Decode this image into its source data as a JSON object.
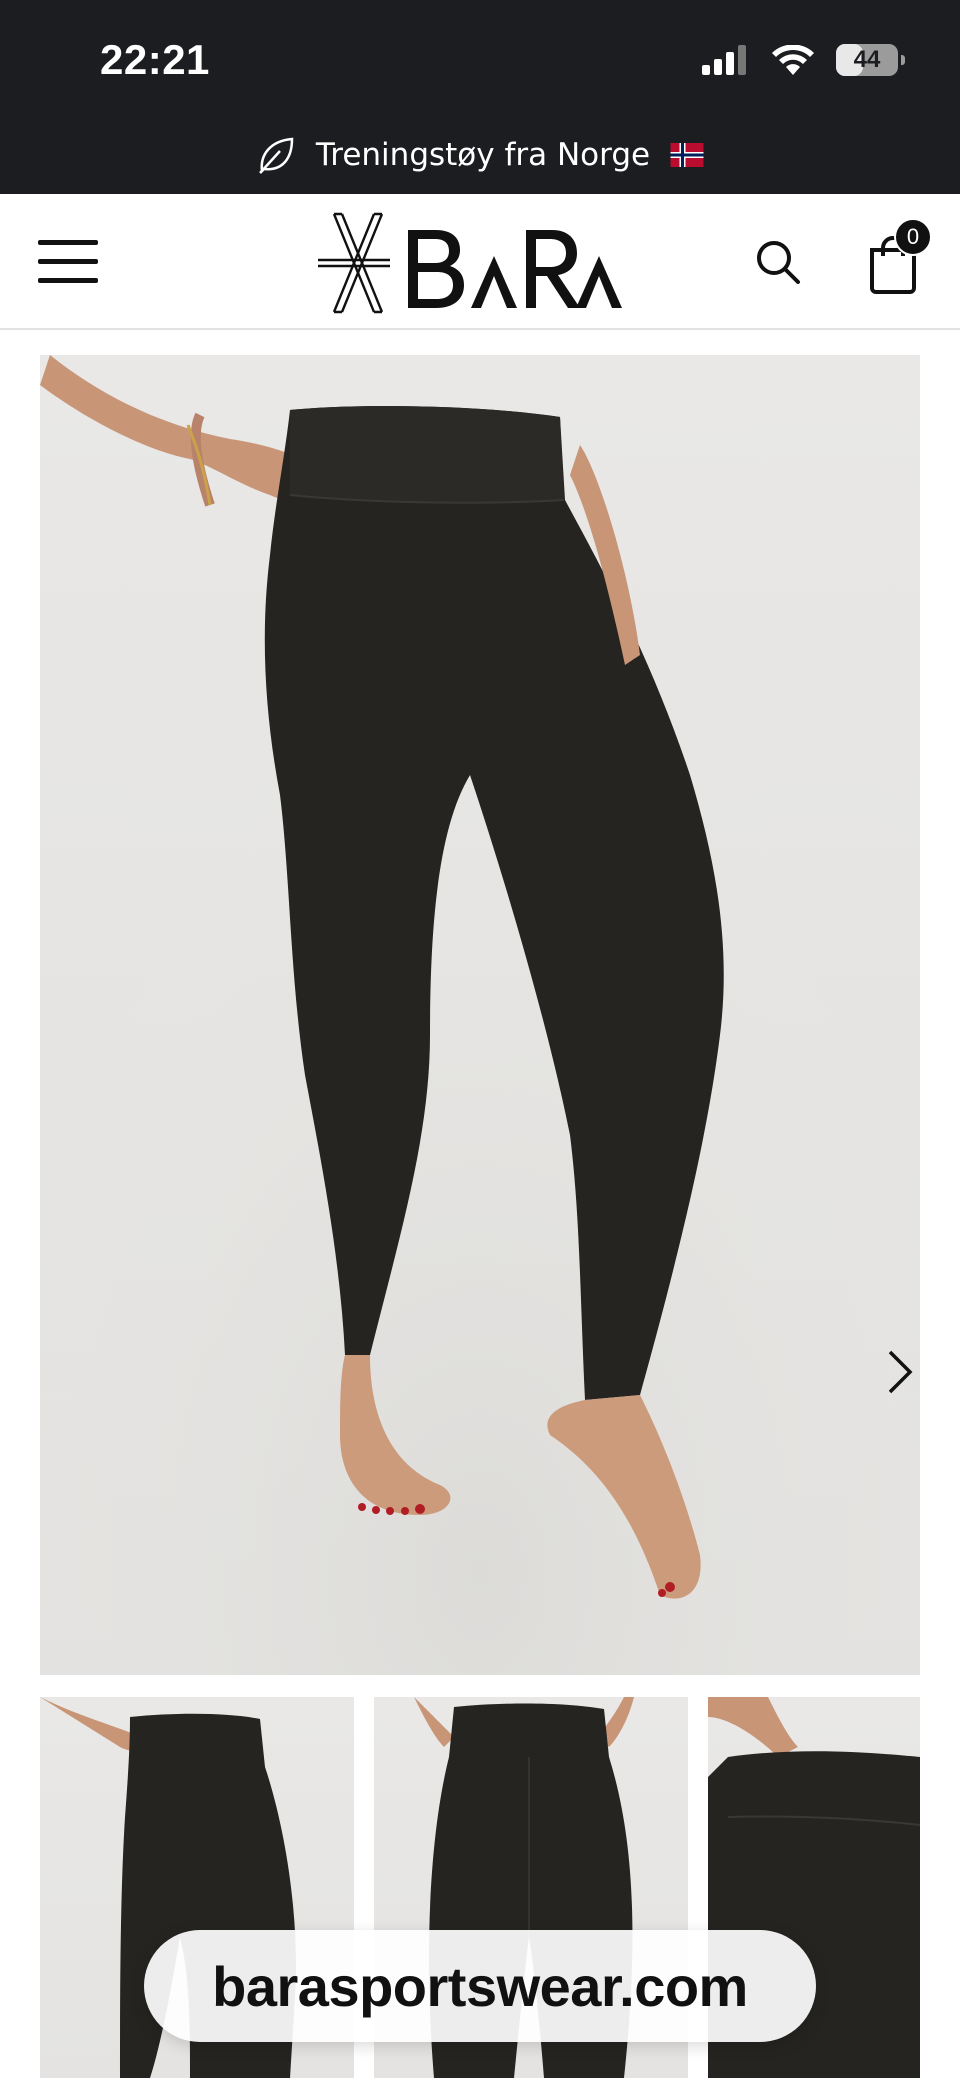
{
  "status_bar": {
    "time": "22:21",
    "battery_percent": 44,
    "battery_label": "44",
    "icons": [
      "signal-icon",
      "wifi-icon",
      "battery-icon"
    ]
  },
  "announcement": {
    "text": "Treningstøy fra Norge",
    "icon": "leaf-icon",
    "flag": "norway-flag-icon"
  },
  "header": {
    "logo_text": "BARA",
    "menu_icon": "hamburger-icon",
    "search_icon": "search-icon",
    "cart_icon": "shopping-bag-icon",
    "cart_count": "0"
  },
  "gallery": {
    "main_image": "product-photo-black-leggings-front",
    "next_icon": "chevron-right-icon",
    "thumbnails": [
      "product-photo-black-leggings-front",
      "product-photo-black-leggings-back",
      "product-photo-black-leggings-waist-detail"
    ]
  },
  "browser": {
    "url": "barasportswear.com"
  },
  "colors": {
    "dark_bar": "#1c1d21",
    "leggings": "#262421",
    "photo_background": "#e7e6e4"
  }
}
